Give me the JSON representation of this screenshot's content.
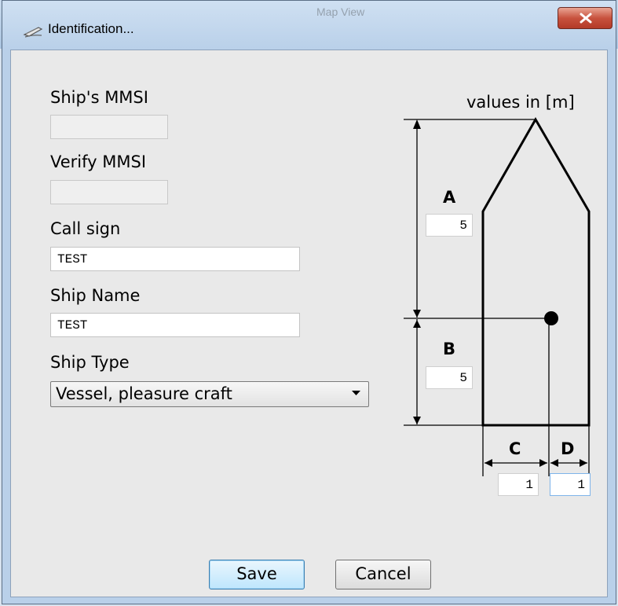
{
  "window": {
    "title": "Identification...",
    "background_title": "Map View"
  },
  "form": {
    "mmsi_label": "Ship's MMSI",
    "mmsi_value": "",
    "verify_label": "Verify MMSI",
    "verify_value": "",
    "callsign_label": "Call sign",
    "callsign_value": "TEST",
    "shipname_label": "Ship Name",
    "shipname_value": "TEST",
    "shiptype_label": "Ship Type",
    "shiptype_value": "Vessel, pleasure craft"
  },
  "dimensions": {
    "units_label": "values in [m]",
    "a_label": "A",
    "a_value": "5",
    "b_label": "B",
    "b_value": "5",
    "c_label": "C",
    "c_value": "1",
    "d_label": "D",
    "d_value": "1"
  },
  "buttons": {
    "save": "Save",
    "cancel": "Cancel"
  },
  "colors": {
    "close_button": "#c8523e",
    "default_button": "#bee6fd",
    "dialog_bg": "#e9e9e9"
  }
}
